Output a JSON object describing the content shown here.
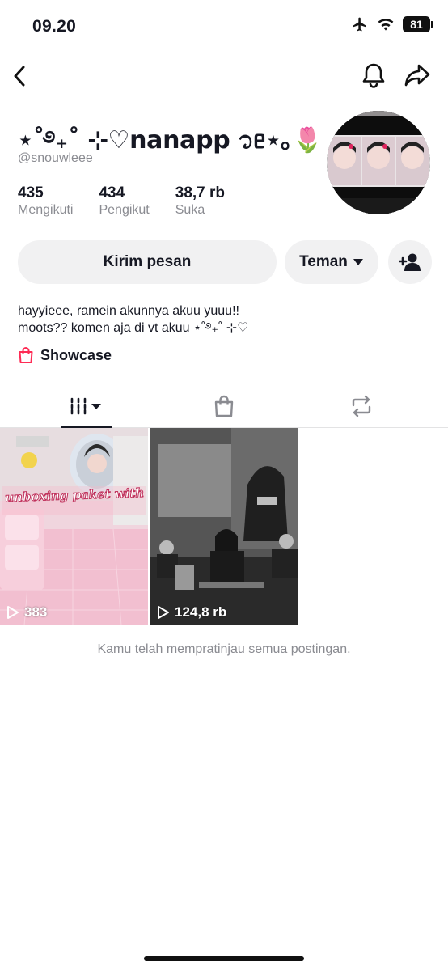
{
  "status_bar": {
    "time": "09.20",
    "battery": "81"
  },
  "profile": {
    "display_name": "⋆˚࿔₊˚ ⊹♡nanapp ᭡ᥱ⋆｡",
    "display_name_emoji": "🌷",
    "username": "@snouwleee",
    "stats": [
      {
        "value": "435",
        "label": "Mengikuti"
      },
      {
        "value": "434",
        "label": "Pengikut"
      },
      {
        "value": "38,7 rb",
        "label": "Suka"
      }
    ],
    "bio_line1": "hayyieee, ramein akunnya akuu yuuu!!",
    "bio_line2": "moots?? komen aja di vt akuu ⋆˚࿔₊˚ ⊹♡",
    "showcase_label": "Showcase"
  },
  "actions": {
    "message_label": "Kirim pesan",
    "friend_label": "Teman"
  },
  "videos": [
    {
      "views": "383",
      "overlay_text": "unboxing paket with nafa"
    },
    {
      "views": "124,8 rb"
    }
  ],
  "preview_note": "Kamu telah mempratinjau semua postingan.",
  "colors": {
    "accent": "#fe2c55",
    "text": "#161823",
    "muted": "#8a8b91",
    "button_bg": "#f1f1f2"
  }
}
